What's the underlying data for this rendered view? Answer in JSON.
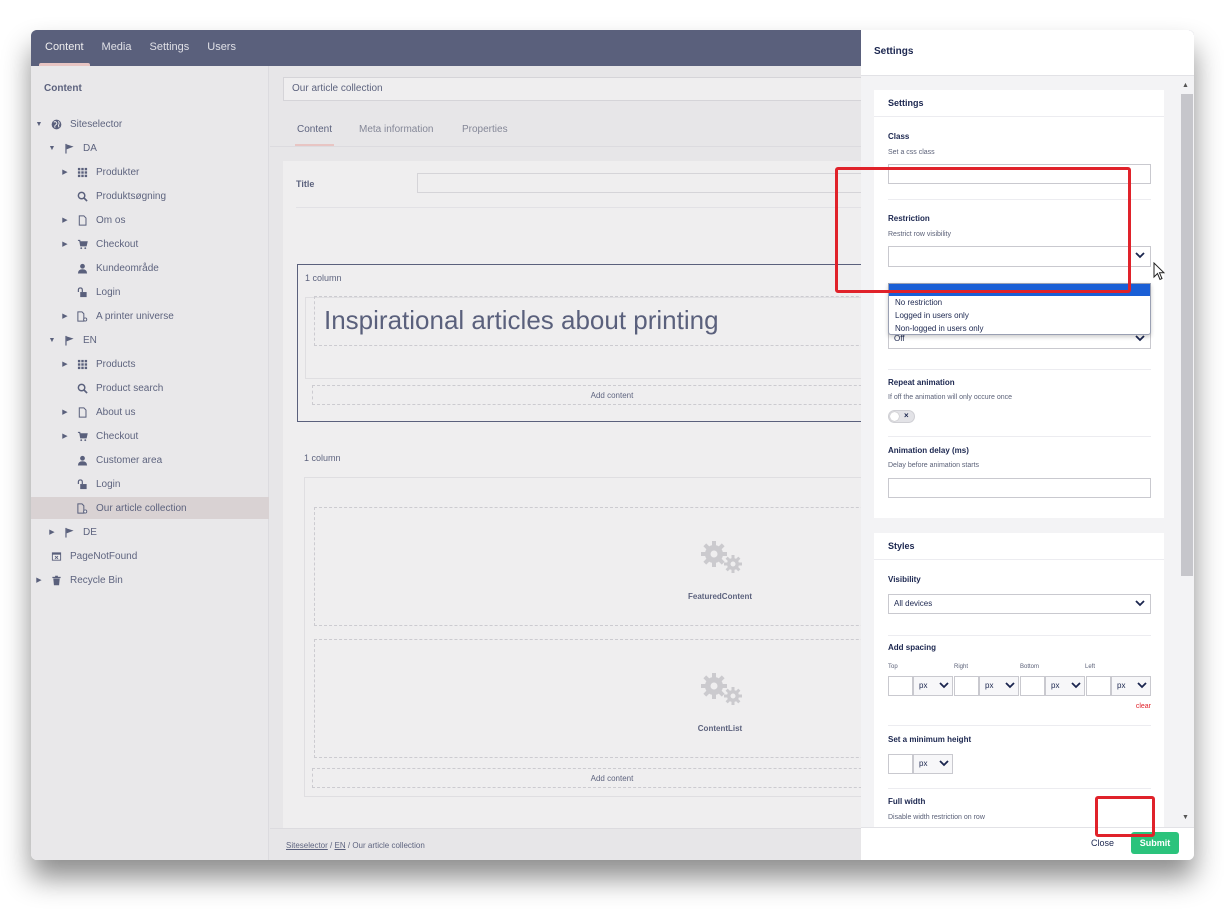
{
  "topnav": {
    "tabs": [
      "Content",
      "Media",
      "Settings",
      "Users"
    ],
    "active": "Content"
  },
  "tree": {
    "heading": "Content",
    "nodes": [
      {
        "label": "Siteselector",
        "icon": "globe-icon",
        "depth": 0,
        "caret": "down"
      },
      {
        "label": "DA",
        "icon": "flag-icon",
        "depth": 1,
        "caret": "down"
      },
      {
        "label": "Produkter",
        "icon": "grid-icon",
        "depth": 2,
        "caret": "right"
      },
      {
        "label": "Produktsøgning",
        "icon": "search-icon",
        "depth": 2,
        "caret": ""
      },
      {
        "label": "Om os",
        "icon": "document-icon",
        "depth": 2,
        "caret": "right"
      },
      {
        "label": "Checkout",
        "icon": "cart-icon",
        "depth": 2,
        "caret": "right"
      },
      {
        "label": "Kundeområde",
        "icon": "user-icon",
        "depth": 2,
        "caret": ""
      },
      {
        "label": "Login",
        "icon": "unlock-icon",
        "depth": 2,
        "caret": ""
      },
      {
        "label": "A printer universe",
        "icon": "document-settings-icon",
        "depth": 2,
        "caret": "right"
      },
      {
        "label": "EN",
        "icon": "flag-icon",
        "depth": 1,
        "caret": "down"
      },
      {
        "label": "Products",
        "icon": "grid-icon",
        "depth": 2,
        "caret": "right"
      },
      {
        "label": "Product search",
        "icon": "search-icon",
        "depth": 2,
        "caret": ""
      },
      {
        "label": "About us",
        "icon": "document-icon",
        "depth": 2,
        "caret": "right"
      },
      {
        "label": "Checkout",
        "icon": "cart-icon",
        "depth": 2,
        "caret": "right"
      },
      {
        "label": "Customer area",
        "icon": "user-icon",
        "depth": 2,
        "caret": ""
      },
      {
        "label": "Login",
        "icon": "unlock-icon",
        "depth": 2,
        "caret": ""
      },
      {
        "label": "Our article collection",
        "icon": "document-settings-icon",
        "depth": 2,
        "caret": "",
        "selected": true
      },
      {
        "label": "DE",
        "icon": "flag-icon",
        "depth": 1,
        "caret": "right"
      },
      {
        "label": "PageNotFound",
        "icon": "window-icon",
        "depth": 0,
        "caret": ""
      },
      {
        "label": "Recycle Bin",
        "icon": "trash-icon",
        "depth": 0,
        "caret": "right"
      }
    ]
  },
  "editor": {
    "doc_name": "Our article collection",
    "tabs": [
      "Content",
      "Meta information",
      "Properties"
    ],
    "title_label": "Title",
    "row1_label": "1 column",
    "headline": "Inspirational articles about printing",
    "add_content": "Add content",
    "row2_label": "1 column",
    "macro1": "FeaturedContent",
    "macro2": "ContentList",
    "breadcrumb": {
      "part1": "Siteselector",
      "sep": "/",
      "part2": "EN",
      "current": "Our article collection"
    }
  },
  "panel": {
    "header": "Settings",
    "settings_section": "Settings",
    "class_label": "Class",
    "class_desc": "Set a css class",
    "restriction_label": "Restriction",
    "restriction_desc": "Restrict row visibility",
    "restriction_options": [
      "No restriction",
      "Logged in users only",
      "Non-logged in users only"
    ],
    "animation_value": "Off",
    "repeat_label": "Repeat animation",
    "repeat_desc": "If off the animation will only occure once",
    "repeat_toggle_mark": "×",
    "delay_label": "Animation delay (ms)",
    "delay_desc": "Delay before animation starts",
    "styles_section": "Styles",
    "visibility_label": "Visibility",
    "visibility_value": "All devices",
    "spacing_label": "Add spacing",
    "spacing": {
      "top": "Top",
      "right": "Right",
      "bottom": "Bottom",
      "left": "Left",
      "unit": "px"
    },
    "clear": "clear",
    "minheight_label": "Set a minimum height",
    "minheight_unit": "px",
    "fullwidth_label": "Full width",
    "fullwidth_desc": "Disable width restriction on row",
    "close": "Close",
    "submit": "Submit"
  },
  "colors": {
    "nav": "#1b264f",
    "accent": "#f5c1bc",
    "submit": "#2bc37c",
    "highlight": "#e0222a"
  }
}
